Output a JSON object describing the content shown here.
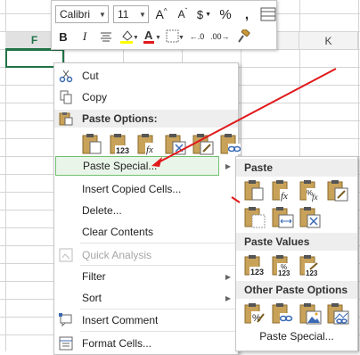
{
  "colors": {
    "accent": "#217346",
    "annotation": "#e0191b"
  },
  "columns": {
    "selected": "F",
    "other": "K"
  },
  "mini_toolbar": {
    "font_name": "Calibri",
    "font_size": "11",
    "bold": "B",
    "italic": "I",
    "grow_font": "A",
    "shrink_font": "A",
    "currency": "$",
    "percent": "%",
    "comma": ",",
    "inc_decimal": "←.0",
    "dec_decimal": ".00→"
  },
  "context_menu": {
    "cut": "Cut",
    "copy": "Copy",
    "paste_options": "Paste Options:",
    "paste_special": "Paste Special...",
    "insert_copied": "Insert Copied Cells...",
    "delete": "Delete...",
    "clear_contents": "Clear Contents",
    "quick_analysis": "Quick Analysis",
    "filter": "Filter",
    "sort": "Sort",
    "insert_comment": "Insert Comment",
    "format_cells": "Format Cells..."
  },
  "submenu": {
    "paste": "Paste",
    "paste_values": "Paste Values",
    "other_paste_options": "Other Paste Options",
    "paste_special": "Paste Special..."
  },
  "icons": {
    "cut": "scissors-icon",
    "copy": "copy-icon",
    "paste": "clipboard-icon",
    "quick_analysis": "quick-analysis-icon",
    "comment": "comment-icon",
    "format_cells": "format-cells-icon"
  },
  "tags": {
    "values": "123",
    "formula": "fx",
    "percent": "%"
  }
}
